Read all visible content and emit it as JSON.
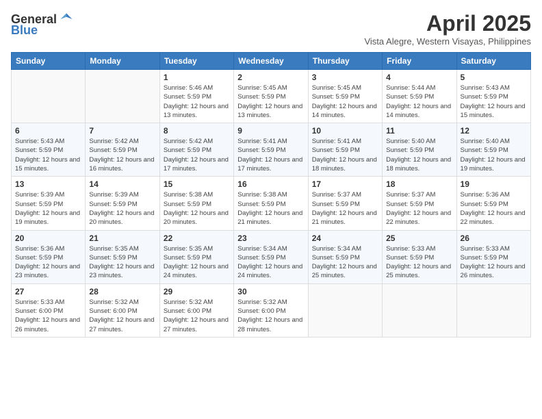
{
  "logo": {
    "general": "General",
    "blue": "Blue"
  },
  "header": {
    "month_year": "April 2025",
    "location": "Vista Alegre, Western Visayas, Philippines"
  },
  "weekdays": [
    "Sunday",
    "Monday",
    "Tuesday",
    "Wednesday",
    "Thursday",
    "Friday",
    "Saturday"
  ],
  "weeks": [
    [
      {
        "day": "",
        "sunrise": "",
        "sunset": "",
        "daylight": ""
      },
      {
        "day": "",
        "sunrise": "",
        "sunset": "",
        "daylight": ""
      },
      {
        "day": "1",
        "sunrise": "Sunrise: 5:46 AM",
        "sunset": "Sunset: 5:59 PM",
        "daylight": "Daylight: 12 hours and 13 minutes."
      },
      {
        "day": "2",
        "sunrise": "Sunrise: 5:45 AM",
        "sunset": "Sunset: 5:59 PM",
        "daylight": "Daylight: 12 hours and 13 minutes."
      },
      {
        "day": "3",
        "sunrise": "Sunrise: 5:45 AM",
        "sunset": "Sunset: 5:59 PM",
        "daylight": "Daylight: 12 hours and 14 minutes."
      },
      {
        "day": "4",
        "sunrise": "Sunrise: 5:44 AM",
        "sunset": "Sunset: 5:59 PM",
        "daylight": "Daylight: 12 hours and 14 minutes."
      },
      {
        "day": "5",
        "sunrise": "Sunrise: 5:43 AM",
        "sunset": "Sunset: 5:59 PM",
        "daylight": "Daylight: 12 hours and 15 minutes."
      }
    ],
    [
      {
        "day": "6",
        "sunrise": "Sunrise: 5:43 AM",
        "sunset": "Sunset: 5:59 PM",
        "daylight": "Daylight: 12 hours and 15 minutes."
      },
      {
        "day": "7",
        "sunrise": "Sunrise: 5:42 AM",
        "sunset": "Sunset: 5:59 PM",
        "daylight": "Daylight: 12 hours and 16 minutes."
      },
      {
        "day": "8",
        "sunrise": "Sunrise: 5:42 AM",
        "sunset": "Sunset: 5:59 PM",
        "daylight": "Daylight: 12 hours and 17 minutes."
      },
      {
        "day": "9",
        "sunrise": "Sunrise: 5:41 AM",
        "sunset": "Sunset: 5:59 PM",
        "daylight": "Daylight: 12 hours and 17 minutes."
      },
      {
        "day": "10",
        "sunrise": "Sunrise: 5:41 AM",
        "sunset": "Sunset: 5:59 PM",
        "daylight": "Daylight: 12 hours and 18 minutes."
      },
      {
        "day": "11",
        "sunrise": "Sunrise: 5:40 AM",
        "sunset": "Sunset: 5:59 PM",
        "daylight": "Daylight: 12 hours and 18 minutes."
      },
      {
        "day": "12",
        "sunrise": "Sunrise: 5:40 AM",
        "sunset": "Sunset: 5:59 PM",
        "daylight": "Daylight: 12 hours and 19 minutes."
      }
    ],
    [
      {
        "day": "13",
        "sunrise": "Sunrise: 5:39 AM",
        "sunset": "Sunset: 5:59 PM",
        "daylight": "Daylight: 12 hours and 19 minutes."
      },
      {
        "day": "14",
        "sunrise": "Sunrise: 5:39 AM",
        "sunset": "Sunset: 5:59 PM",
        "daylight": "Daylight: 12 hours and 20 minutes."
      },
      {
        "day": "15",
        "sunrise": "Sunrise: 5:38 AM",
        "sunset": "Sunset: 5:59 PM",
        "daylight": "Daylight: 12 hours and 20 minutes."
      },
      {
        "day": "16",
        "sunrise": "Sunrise: 5:38 AM",
        "sunset": "Sunset: 5:59 PM",
        "daylight": "Daylight: 12 hours and 21 minutes."
      },
      {
        "day": "17",
        "sunrise": "Sunrise: 5:37 AM",
        "sunset": "Sunset: 5:59 PM",
        "daylight": "Daylight: 12 hours and 21 minutes."
      },
      {
        "day": "18",
        "sunrise": "Sunrise: 5:37 AM",
        "sunset": "Sunset: 5:59 PM",
        "daylight": "Daylight: 12 hours and 22 minutes."
      },
      {
        "day": "19",
        "sunrise": "Sunrise: 5:36 AM",
        "sunset": "Sunset: 5:59 PM",
        "daylight": "Daylight: 12 hours and 22 minutes."
      }
    ],
    [
      {
        "day": "20",
        "sunrise": "Sunrise: 5:36 AM",
        "sunset": "Sunset: 5:59 PM",
        "daylight": "Daylight: 12 hours and 23 minutes."
      },
      {
        "day": "21",
        "sunrise": "Sunrise: 5:35 AM",
        "sunset": "Sunset: 5:59 PM",
        "daylight": "Daylight: 12 hours and 23 minutes."
      },
      {
        "day": "22",
        "sunrise": "Sunrise: 5:35 AM",
        "sunset": "Sunset: 5:59 PM",
        "daylight": "Daylight: 12 hours and 24 minutes."
      },
      {
        "day": "23",
        "sunrise": "Sunrise: 5:34 AM",
        "sunset": "Sunset: 5:59 PM",
        "daylight": "Daylight: 12 hours and 24 minutes."
      },
      {
        "day": "24",
        "sunrise": "Sunrise: 5:34 AM",
        "sunset": "Sunset: 5:59 PM",
        "daylight": "Daylight: 12 hours and 25 minutes."
      },
      {
        "day": "25",
        "sunrise": "Sunrise: 5:33 AM",
        "sunset": "Sunset: 5:59 PM",
        "daylight": "Daylight: 12 hours and 25 minutes."
      },
      {
        "day": "26",
        "sunrise": "Sunrise: 5:33 AM",
        "sunset": "Sunset: 5:59 PM",
        "daylight": "Daylight: 12 hours and 26 minutes."
      }
    ],
    [
      {
        "day": "27",
        "sunrise": "Sunrise: 5:33 AM",
        "sunset": "Sunset: 6:00 PM",
        "daylight": "Daylight: 12 hours and 26 minutes."
      },
      {
        "day": "28",
        "sunrise": "Sunrise: 5:32 AM",
        "sunset": "Sunset: 6:00 PM",
        "daylight": "Daylight: 12 hours and 27 minutes."
      },
      {
        "day": "29",
        "sunrise": "Sunrise: 5:32 AM",
        "sunset": "Sunset: 6:00 PM",
        "daylight": "Daylight: 12 hours and 27 minutes."
      },
      {
        "day": "30",
        "sunrise": "Sunrise: 5:32 AM",
        "sunset": "Sunset: 6:00 PM",
        "daylight": "Daylight: 12 hours and 28 minutes."
      },
      {
        "day": "",
        "sunrise": "",
        "sunset": "",
        "daylight": ""
      },
      {
        "day": "",
        "sunrise": "",
        "sunset": "",
        "daylight": ""
      },
      {
        "day": "",
        "sunrise": "",
        "sunset": "",
        "daylight": ""
      }
    ]
  ]
}
